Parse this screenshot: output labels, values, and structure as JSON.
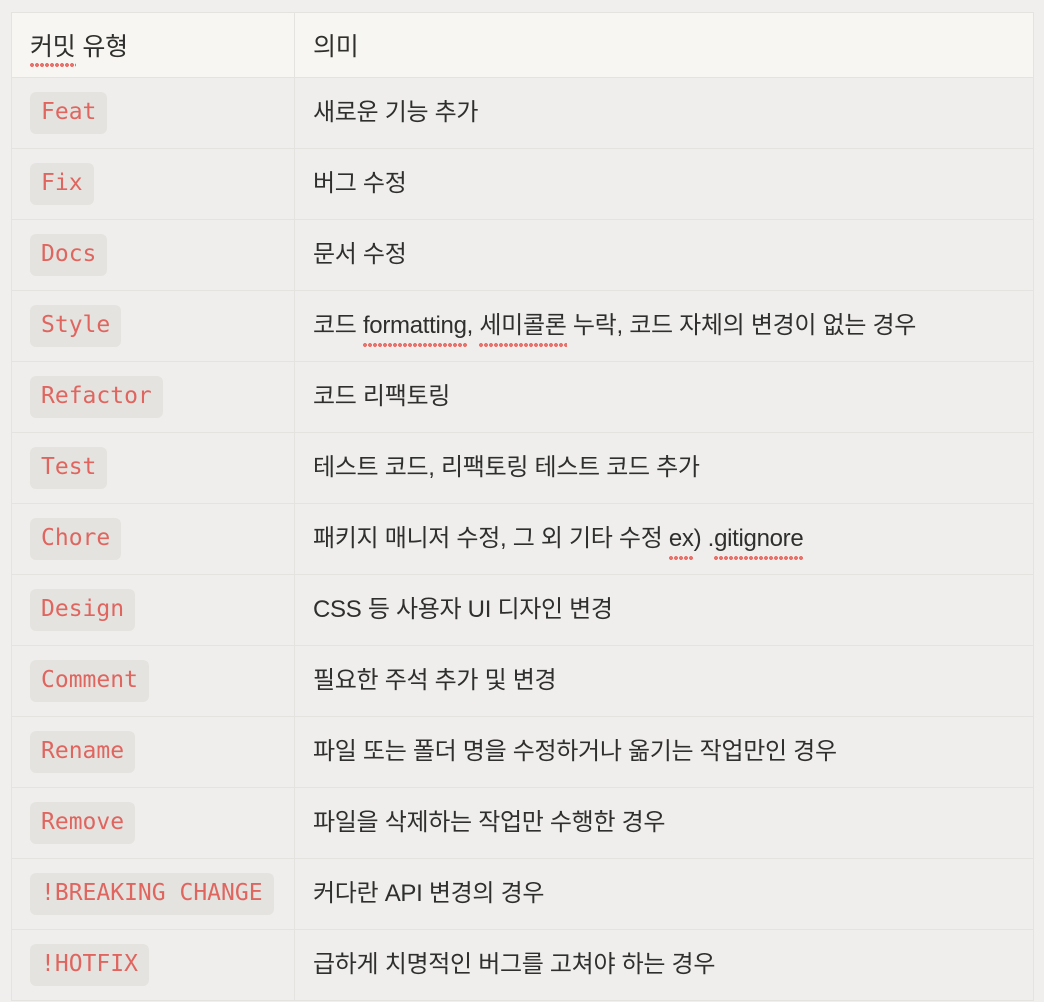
{
  "theme": {
    "page_background": "#f0efed",
    "header_background": "#f7f6f2",
    "row_background": "#efeeec",
    "border_color": "#e4e3df",
    "badge_background": "#e4e3df",
    "badge_text_color": "#e0655f",
    "text_color": "#2f2f2d",
    "spellcheck_underline_color": "#e8736c"
  },
  "table": {
    "headers": {
      "type": "커밋 유형",
      "type_spellcheck_segment": "커밋",
      "type_plain_segment": " 유형",
      "meaning": "의미"
    },
    "rows": [
      {
        "badge": "Feat",
        "desc": "새로운 기능 추가",
        "parts": [
          {
            "text": "새로운 기능 추가",
            "spell": false
          }
        ]
      },
      {
        "badge": "Fix",
        "desc": "버그 수정",
        "parts": [
          {
            "text": "버그 수정",
            "spell": false
          }
        ]
      },
      {
        "badge": "Docs",
        "desc": "문서 수정",
        "parts": [
          {
            "text": "문서 수정",
            "spell": false
          }
        ]
      },
      {
        "badge": "Style",
        "desc": "코드 formatting, 세미콜론 누락, 코드 자체의 변경이 없는 경우",
        "parts": [
          {
            "text": "코드 ",
            "spell": false
          },
          {
            "text": "formatting",
            "spell": true
          },
          {
            "text": ", ",
            "spell": false
          },
          {
            "text": "세미콜론",
            "spell": true
          },
          {
            "text": " 누락, 코드 자체의 변경이 없는 경우",
            "spell": false
          }
        ]
      },
      {
        "badge": "Refactor",
        "desc": "코드 리팩토링",
        "parts": [
          {
            "text": "코드 리팩토링",
            "spell": false
          }
        ]
      },
      {
        "badge": "Test",
        "desc": "테스트 코드, 리팩토링 테스트 코드 추가",
        "parts": [
          {
            "text": "테스트 코드, 리팩토링 테스트 코드 추가",
            "spell": false
          }
        ]
      },
      {
        "badge": "Chore",
        "desc": "패키지 매니저 수정, 그 외 기타 수정 ex) .gitignore",
        "parts": [
          {
            "text": "패키지 매니저 수정, 그 외 기타 수정 ",
            "spell": false
          },
          {
            "text": "ex",
            "spell": true
          },
          {
            "text": ") .",
            "spell": false
          },
          {
            "text": "gitignore",
            "spell": true
          }
        ]
      },
      {
        "badge": "Design",
        "desc": "CSS 등 사용자 UI 디자인 변경",
        "parts": [
          {
            "text": "CSS 등 사용자 UI 디자인 변경",
            "spell": false
          }
        ]
      },
      {
        "badge": "Comment",
        "desc": "필요한 주석 추가 및 변경",
        "parts": [
          {
            "text": "필요한 주석 추가 및 변경",
            "spell": false
          }
        ]
      },
      {
        "badge": "Rename",
        "desc": "파일 또는 폴더 명을 수정하거나 옮기는 작업만인 경우",
        "parts": [
          {
            "text": "파일 또는 폴더 명을 수정하거나 옮기는 작업만인 경우",
            "spell": false
          }
        ]
      },
      {
        "badge": "Remove",
        "desc": "파일을 삭제하는 작업만 수행한 경우",
        "parts": [
          {
            "text": "파일을 삭제하는 작업만 수행한 경우",
            "spell": false
          }
        ]
      },
      {
        "badge": "!BREAKING CHANGE",
        "desc": "커다란 API 변경의 경우",
        "parts": [
          {
            "text": "커다란 API 변경의 경우",
            "spell": false
          }
        ]
      },
      {
        "badge": "!HOTFIX",
        "desc": "급하게 치명적인 버그를 고쳐야 하는 경우",
        "parts": [
          {
            "text": "급하게 치명적인 버그를 고쳐야 하는 경우",
            "spell": false
          }
        ]
      }
    ]
  }
}
